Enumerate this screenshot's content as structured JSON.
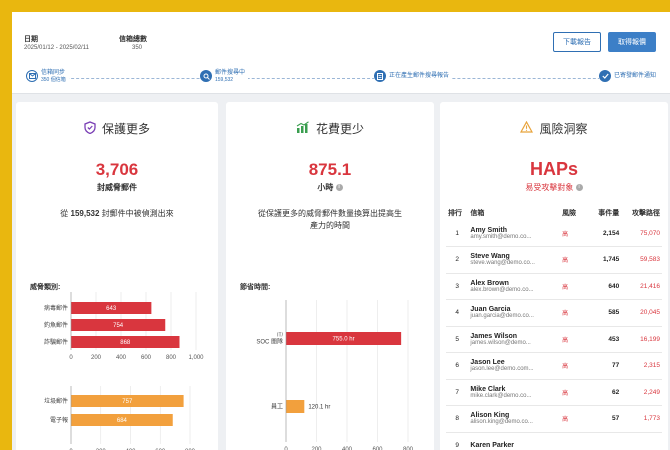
{
  "header": {
    "date_label": "日期",
    "date_value": "2025/01/12 - 2025/02/11",
    "mail_label": "信箱總數",
    "mail_value": "350",
    "download_button": "下載報告",
    "get_button": "取得報價"
  },
  "progress": [
    {
      "title": "信箱同步",
      "sub": "350 個信箱",
      "icon": "mail-icon"
    },
    {
      "title": "郵件搜尋中",
      "sub": "159,532",
      "icon": "search-icon"
    },
    {
      "title": "正在產生郵件搜尋報告",
      "sub": "",
      "icon": "report-icon"
    },
    {
      "title": "已寄發郵件通知",
      "sub": "",
      "icon": "check-icon"
    }
  ],
  "card1": {
    "title": "保護更多",
    "big": "3,706",
    "sub": "封威脅郵件",
    "desc_prefix": "從 ",
    "desc_number": "159,532",
    "desc_suffix": " 封郵件中被偵測出來",
    "threat_label": "威脅類別:"
  },
  "card2": {
    "title": "花費更少",
    "big": "875.1",
    "sub": "小時",
    "desc": "從保護更多的威脅郵件數量換算出提高生產力的時間",
    "time_label": "節省時間:"
  },
  "card3": {
    "title": "風險洞察",
    "big": "HAPs",
    "sub": "易受攻擊對象",
    "columns": [
      "排行",
      "信箱",
      "風險",
      "事件量",
      "攻擊路徑"
    ],
    "risk_text": "高",
    "rows": [
      {
        "rank": "1",
        "name": "Amy Smith",
        "email": "amy.smith@demo.co...",
        "count": "2,154",
        "path": "75,070"
      },
      {
        "rank": "2",
        "name": "Steve Wang",
        "email": "steve.wang@demo.co...",
        "count": "1,745",
        "path": "59,583"
      },
      {
        "rank": "3",
        "name": "Alex Brown",
        "email": "alex.brown@demo.co...",
        "count": "640",
        "path": "21,416"
      },
      {
        "rank": "4",
        "name": "Juan Garcia",
        "email": "juan.garcia@demo.co...",
        "count": "585",
        "path": "20,045"
      },
      {
        "rank": "5",
        "name": "James Wilson",
        "email": "james.wilson@demo...",
        "count": "453",
        "path": "16,199"
      },
      {
        "rank": "6",
        "name": "Jason Lee",
        "email": "jason.lee@demo.com...",
        "count": "77",
        "path": "2,315"
      },
      {
        "rank": "7",
        "name": "Mike Clark",
        "email": "mike.clark@demo.co...",
        "count": "62",
        "path": "2,249"
      },
      {
        "rank": "8",
        "name": "Alison King",
        "email": "alison.king@demo.co...",
        "count": "57",
        "path": "1,773"
      },
      {
        "rank": "9",
        "name": "Karen Parker",
        "email": "",
        "count": "",
        "path": ""
      }
    ]
  },
  "colors": {
    "red_bar": "#d9363e",
    "orange_bar": "#f2a03d",
    "brand_blue": "#2f6fb3",
    "accent_red": "#d9363e"
  },
  "chart_data": [
    {
      "type": "bar",
      "orientation": "horizontal",
      "categories": [
        "病毒郵件",
        "釣魚郵件",
        "詐騙郵件"
      ],
      "values": [
        643,
        754,
        868
      ],
      "xlim": [
        0,
        1000
      ],
      "ticks": [
        "0",
        "200",
        "400",
        "600",
        "800",
        "1,000"
      ],
      "value_labels": [
        "643",
        "754",
        "868"
      ]
    },
    {
      "type": "bar",
      "orientation": "horizontal",
      "categories": [
        "垃圾郵件",
        "電子報"
      ],
      "values": [
        757,
        684
      ],
      "xlim": [
        0,
        800
      ],
      "ticks": [
        "0",
        "200",
        "400",
        "600",
        "800"
      ],
      "value_labels": [
        "757",
        "684"
      ]
    },
    {
      "type": "bar",
      "orientation": "horizontal",
      "categories": [
        "SOC 團隊",
        "員工"
      ],
      "category_prefix": [
        "IT/",
        ""
      ],
      "values": [
        755.0,
        120.1
      ],
      "xlim": [
        0,
        800
      ],
      "ticks": [
        "0",
        "200",
        "400",
        "600",
        "800"
      ],
      "value_labels": [
        "755.0 hr",
        "120.1 hr"
      ]
    }
  ]
}
